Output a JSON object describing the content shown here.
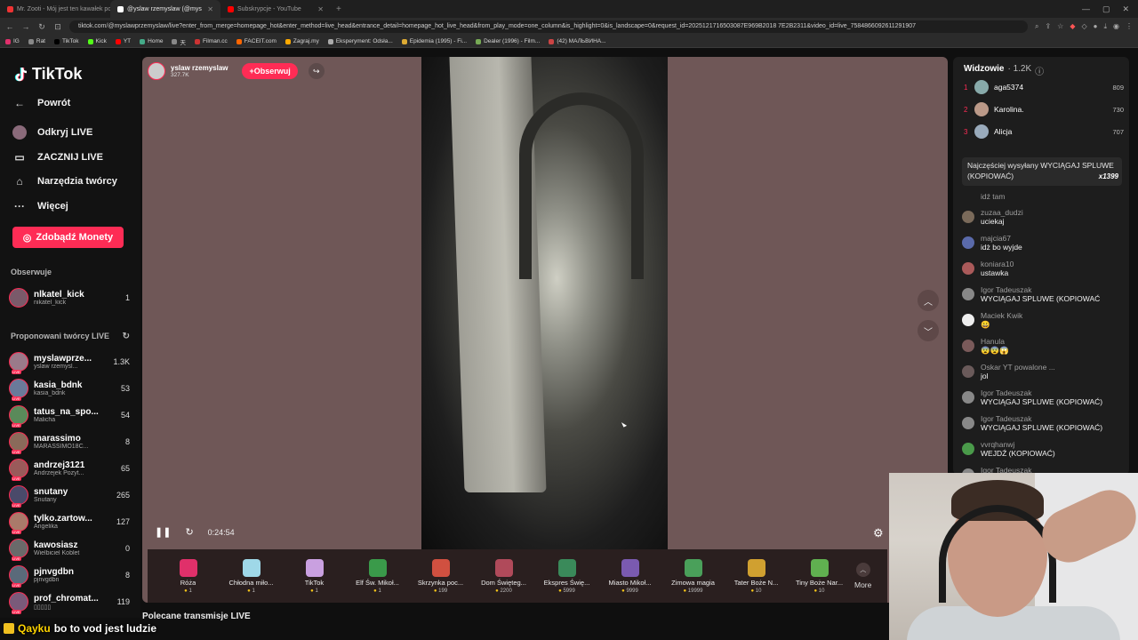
{
  "browser": {
    "tabs": [
      {
        "title": "Mr. Zooti - Mój jest ten kawałek pod",
        "color": "#e33"
      },
      {
        "title": "@yslaw rzemyslaw (@mys",
        "color": "#fff",
        "active": true
      },
      {
        "title": "Subskrypcje - YouTube",
        "color": "#f00"
      }
    ],
    "url": "tiktok.com/@myslawprzemyslaw/live?enter_from_merge=homepage_hot&enter_method=live_head&entrance_detail=homepage_hot_live_head&from_play_mode=one_column&is_highlight=0&is_landscape=0&request_id=2025121716503087E969B2018 7E2B2311&video_id=live_7584866092611291907",
    "bookmarks": [
      "IG",
      "Rat",
      "TikTok",
      "Kick",
      "YT",
      "Home",
      "天",
      "Filman.cc",
      "FACEIT.com",
      "Zagraj.my",
      "Eksperyment: Odsła...",
      "Epidemia (1995) - Fi...",
      "Dealer (1996) - Film...",
      "(42) МАЛЬВИНА..."
    ]
  },
  "sidebar": {
    "logo": "TikTok",
    "nav": [
      {
        "label": "Powrót",
        "icon": "back-arrow-icon",
        "glyph": "←"
      },
      {
        "label": "Odkryj LIVE",
        "icon": "discover-live-icon",
        "glyph": "●"
      },
      {
        "label": "ZACZNIJ LIVE",
        "icon": "camera-icon",
        "glyph": "▭"
      },
      {
        "label": "Narzędzia twórcy",
        "icon": "home-icon",
        "glyph": "⌂"
      },
      {
        "label": "Więcej",
        "icon": "more-icon",
        "glyph": "···"
      }
    ],
    "coins_button": "Zdobądź Monety",
    "following_title": "Obserwuje",
    "following": [
      {
        "name": "nlkatel_kick",
        "sub": "nikatel_kick",
        "count": "1",
        "color": "#7a5a6a"
      }
    ],
    "suggested_title": "Proponowani twórcy LIVE",
    "suggested": [
      {
        "name": "myslawprze...",
        "sub": "yslaw rzemysl...",
        "count": "1.3K",
        "color": "#9a7a8a"
      },
      {
        "name": "kasia_bdnk",
        "sub": "kasia_bdnk",
        "count": "53",
        "color": "#6a7a9a"
      },
      {
        "name": "tatus_na_spo...",
        "sub": "Malicha",
        "count": "54",
        "color": "#5a8a5a"
      },
      {
        "name": "marassimo",
        "sub": "MARASSIMO18C...",
        "count": "8",
        "color": "#8a6a5a"
      },
      {
        "name": "andrzej3121",
        "sub": "Andrzejek Pozyt...",
        "count": "65",
        "color": "#9a5a5a"
      },
      {
        "name": "snutany",
        "sub": "Snutany",
        "count": "265",
        "color": "#4a4a6a"
      },
      {
        "name": "tylko.zartow...",
        "sub": "Angelika",
        "count": "127",
        "color": "#aa7a6a"
      },
      {
        "name": "kawosiasz",
        "sub": "Wielbiciel Koblet",
        "count": "0",
        "color": "#6a6a6a"
      },
      {
        "name": "pjnvgdbn",
        "sub": "pjnvgdbn",
        "count": "8",
        "color": "#5a6a7a"
      },
      {
        "name": "prof_chromat...",
        "sub": "▯▯▯▯▯",
        "count": "119",
        "color": "#7a5a7a"
      }
    ]
  },
  "stream": {
    "streamer_name": "yslaw rzemyslaw",
    "likes": "327.7K",
    "follow_label": "+Obserwuj",
    "elapsed": "0:24:54",
    "recommended_title": "Polecane transmisje LIVE"
  },
  "gifts": [
    {
      "name": "Róża",
      "price": "1",
      "color": "#e0306a"
    },
    {
      "name": "Chłodna miło...",
      "price": "1",
      "color": "#9fd8e8"
    },
    {
      "name": "TikTok",
      "price": "1",
      "color": "#c9a0e0"
    },
    {
      "name": "Elf Św. Mikoł...",
      "price": "1",
      "color": "#3a9a4a"
    },
    {
      "name": "Skrzynka poc...",
      "price": "199",
      "color": "#d05040"
    },
    {
      "name": "Dom Święteg...",
      "price": "2200",
      "color": "#b04a5a"
    },
    {
      "name": "Ekspres Świę...",
      "price": "5999",
      "color": "#3a8a5a"
    },
    {
      "name": "Miasto Mikoł...",
      "price": "9999",
      "color": "#7a5ab0"
    },
    {
      "name": "Zimowa magia",
      "price": "19999",
      "color": "#4aa05a"
    },
    {
      "name": "Tater Boże N...",
      "price": "10",
      "color": "#d0a030"
    },
    {
      "name": "Tiny Boże Nar...",
      "price": "10",
      "color": "#60b050"
    }
  ],
  "gifts_more": "More",
  "chat": {
    "viewers_title": "Widzowie",
    "viewers_count": "· 1.2K",
    "top": [
      {
        "rank": "1",
        "name": "aga5374",
        "score": "809",
        "color": "#8aa"
      },
      {
        "rank": "2",
        "name": "Karolina.",
        "score": "730",
        "color": "#b98"
      },
      {
        "rank": "3",
        "name": "Alicja",
        "score": "707",
        "color": "#9ab"
      }
    ],
    "banner_text": "Najczęściej wysyłany WYCIĄGAJ SPLUWE (KOPIOWAĆ)",
    "banner_count": "x1399",
    "messages": [
      {
        "user": "idź tam",
        "text": "",
        "color": "#555"
      },
      {
        "user": "zuzaa_dudzi",
        "text": "uciekaj",
        "color": "#7a6a5a"
      },
      {
        "user": "majcia67",
        "text": "idż bo wyjde",
        "color": "#5a6aaa"
      },
      {
        "user": "koniara10",
        "text": "ustawka",
        "color": "#aa5a5a"
      },
      {
        "user": "Igor Tadeuszak",
        "text": "WYCIĄGAJ SPLUWE (KOPIOWAĆ",
        "color": "#888"
      },
      {
        "user": "Maciek Kwik",
        "text": "😀",
        "color": "#eee"
      },
      {
        "user": "Hanula",
        "text": "😨😨😱",
        "color": "#7a5a5a"
      },
      {
        "user": "Oskar YT powalone ...",
        "text": "jol",
        "color": "#6a5a5a"
      },
      {
        "user": "Igor Tadeuszak",
        "text": "WYCIĄGAJ SPLUWE (KOPIOWAĆ)",
        "color": "#888"
      },
      {
        "user": "Igor Tadeuszak",
        "text": "WYCIĄGAJ SPLUWE (KOPIOWAĆ)",
        "color": "#888"
      },
      {
        "user": "vvrqhanwj",
        "text": "WEJDŹ (KOPIOWAĆ)",
        "color": "#4a9a4a"
      },
      {
        "user": "Igor Tadeuszak",
        "text": "",
        "color": "#888"
      }
    ]
  },
  "overlay_chat": {
    "user": "Qayku",
    "message": "bo to vod jest ludzie"
  }
}
